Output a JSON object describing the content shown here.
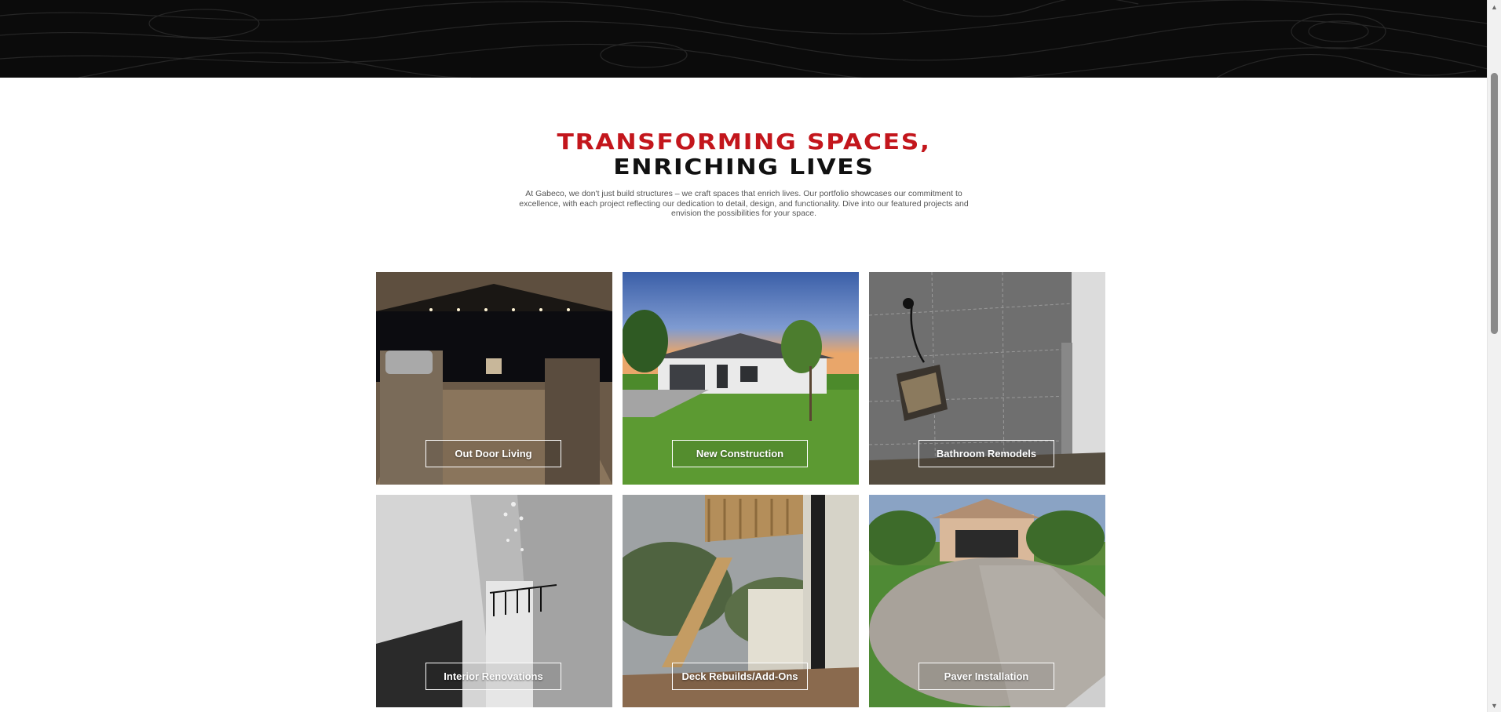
{
  "intro": {
    "heading_line1": "TRANSFORMING SPACES,",
    "heading_line2": "ENRICHING LIVES",
    "paragraph": "At Gabeco, we don't just build structures – we craft spaces that enrich lives. Our portfolio showcases our commitment to excellence, with each project reflecting our dedication to detail, design, and functionality. Dive into our featured projects and envision the possibilities for your space."
  },
  "gallery": {
    "tiles": [
      {
        "label": "Out Door Living"
      },
      {
        "label": "New Construction"
      },
      {
        "label": "Bathroom Remodels"
      },
      {
        "label": "Interior Renovations"
      },
      {
        "label": "Deck Rebuilds/Add-Ons"
      },
      {
        "label": "Paver Installation"
      }
    ]
  },
  "colors": {
    "accent": "#c3161c",
    "heading_dark": "#111111",
    "banner": "#0b0b0b"
  },
  "icons": {
    "scroll_up": "chevron-up-icon",
    "scroll_down": "chevron-down-icon"
  }
}
